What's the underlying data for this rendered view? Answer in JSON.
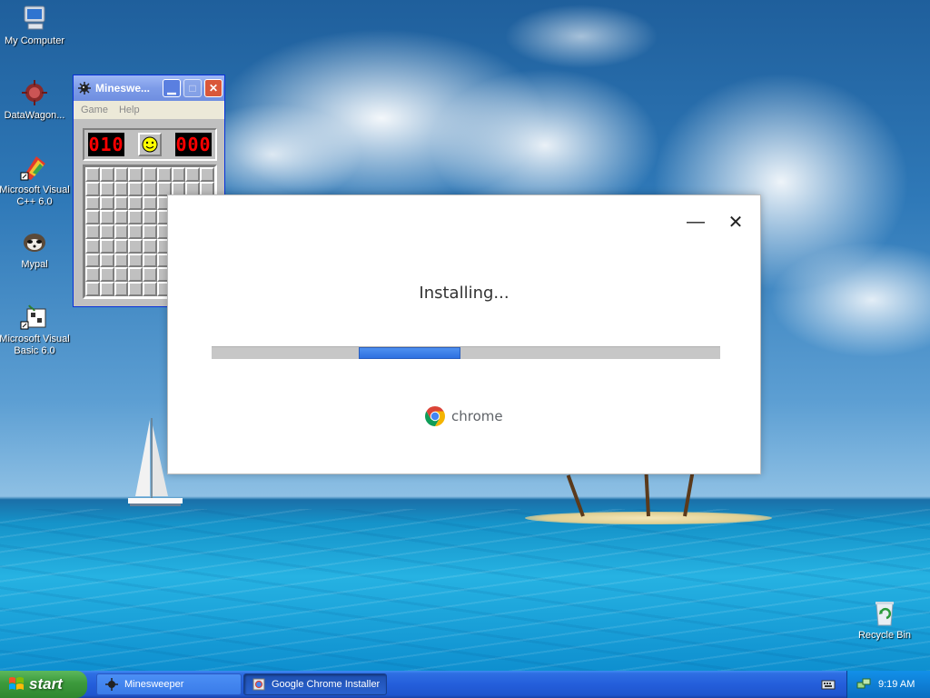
{
  "desktop_icons": [
    {
      "label": "My Computer",
      "icon": "computer-icon"
    },
    {
      "label": "DataWagon...",
      "icon": "datawagon-icon"
    },
    {
      "label": "Microsoft Visual C++ 6.0",
      "icon": "visual-cpp-icon"
    },
    {
      "label": "Mypal",
      "icon": "mypal-icon"
    },
    {
      "label": "Microsoft Visual Basic 6.0",
      "icon": "visual-basic-icon"
    },
    {
      "label": "Recycle Bin",
      "icon": "recycle-bin-icon"
    }
  ],
  "minesweeper": {
    "title": "Mineswe...",
    "menu": [
      "Game",
      "Help"
    ],
    "mine_counter": "010",
    "timer": "000",
    "rows": 9,
    "cols": 9
  },
  "chrome_installer": {
    "status": "Installing...",
    "progress_fraction": 0.2,
    "brand": "chrome"
  },
  "taskbar": {
    "start_label": "start",
    "tasks": [
      {
        "label": "Minesweeper",
        "active": false
      },
      {
        "label": "Google Chrome Installer",
        "active": true
      }
    ],
    "clock": "9:19 AM"
  },
  "colors": {
    "titlebar": "#7d9be8",
    "progress_fill": "#2d6fe0",
    "taskbar": "#245edb",
    "start_button": "#3c9a3c"
  }
}
